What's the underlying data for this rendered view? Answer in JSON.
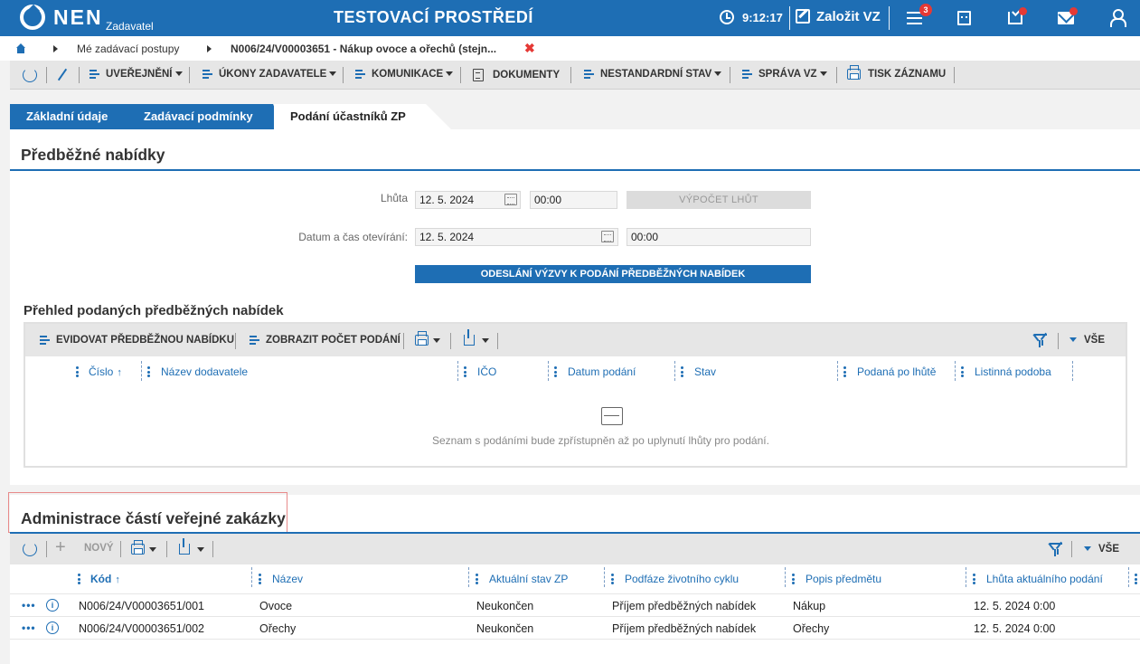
{
  "topbar": {
    "logo": "NEN",
    "logo_sub": "Zadavatel",
    "env_title": "TESTOVACÍ PROSTŘEDÍ",
    "time": "9:12:17",
    "create_label": "Založit VZ",
    "notification_count": "3",
    "colors": {
      "primary": "#1e6eb4",
      "badge": "#e53935"
    }
  },
  "breadcrumb": {
    "items": [
      "Mé zadávací postupy",
      "N006/24/V00003651 - Nákup ovoce a ořechů (stejn..."
    ],
    "close": "✖"
  },
  "actionbar": {
    "items": [
      {
        "label": "UVEŘEJNĚNÍ"
      },
      {
        "label": "ÚKONY ZADAVATELE"
      },
      {
        "label": "KOMUNIKACE"
      },
      {
        "label": "DOKUMENTY"
      },
      {
        "label": "NESTANDARDNÍ STAV"
      },
      {
        "label": "SPRÁVA VZ"
      },
      {
        "label": "TISK ZÁZNAMU"
      }
    ]
  },
  "tabs": [
    "Základní údaje",
    "Zadávací podmínky",
    "Podání účastníků ZP"
  ],
  "preliminary": {
    "title": "Předběžné nabídky",
    "deadline_label": "Lhůta",
    "deadline_date": "12. 5. 2024",
    "deadline_time": "00:00",
    "calc_button": "VÝPOČET LHŮT",
    "opening_label": "Datum a čas otevírání:",
    "opening_date": "12. 5. 2024",
    "opening_time": "00:00",
    "send_button": "ODESLÁNÍ VÝZVY K PODÁNÍ PŘEDBĚŽNÝCH NABÍDEK"
  },
  "overview": {
    "title": "Přehled podaných předběžných nabídek",
    "toolbar": {
      "register": "EVIDOVAT PŘEDBĚŽNOU NABÍDKU",
      "show_count": "ZOBRAZIT POČET PODÁNÍ",
      "all": "VŠE"
    },
    "columns": [
      "Číslo",
      "Název dodavatele",
      "IČO",
      "Datum podání",
      "Stav",
      "Podaná po lhůtě",
      "Listinná podoba"
    ],
    "sort_arrow": "↑",
    "empty_message": "Seznam s podáními bude zpřístupněn až po uplynutí lhůty pro podání."
  },
  "parts": {
    "title": "Administrace částí veřejné zakázky",
    "toolbar": {
      "new": "NOVÝ",
      "all": "VŠE"
    },
    "columns": [
      "Kód",
      "Název",
      "Aktuální stav ZP",
      "Podfáze životního cyklu",
      "Popis předmětu",
      "Lhůta aktuálního podání"
    ],
    "sort_arrow": "↑",
    "rows": [
      {
        "dots": "•••",
        "info": "i",
        "code": "N006/24/V00003651/001",
        "name": "Ovoce",
        "state": "Neukončen",
        "subphase": "Příjem předběžných nabídek",
        "desc": "Nákup",
        "deadline": "12. 5. 2024 0:00"
      },
      {
        "dots": "•••",
        "info": "i",
        "code": "N006/24/V00003651/002",
        "name": "Ořechy",
        "state": "Neukončen",
        "subphase": "Příjem předběžných nabídek",
        "desc": "Ořechy",
        "deadline": "12. 5. 2024 0:00"
      }
    ]
  }
}
